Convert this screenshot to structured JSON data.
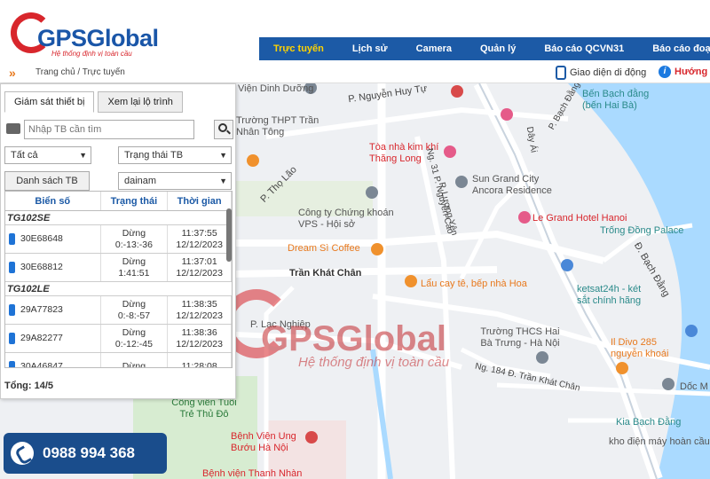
{
  "brand": {
    "name": "GPSGlobal",
    "tagline": "Hệ thống định vị toàn cầu"
  },
  "nav": {
    "items": [
      "Trực tuyến",
      "Lịch sử",
      "Camera",
      "Quản lý",
      "Báo cáo QCVN31",
      "Báo cáo đoạ"
    ],
    "active_index": 0
  },
  "breadcrumb": "Trang chủ / Trực tuyến",
  "header_links": {
    "mobile_ui": "Giao diện di động",
    "guide": "Hướng"
  },
  "panel": {
    "tabs": [
      "Giám sát thiết bị",
      "Xem lại lộ trình"
    ],
    "active_tab": 0,
    "search": {
      "placeholder": "Nhập TB cần tìm",
      "value": ""
    },
    "filter_all": "Tất cả",
    "filter_status": "Trạng thái TB",
    "device_list_button": "Danh sách TB",
    "account_select": "dainam",
    "table": {
      "headers": [
        "Biển số",
        "Trạng thái",
        "Thời gian"
      ],
      "groups": [
        {
          "name": "TG102SE",
          "rows": [
            {
              "plate": "30E68648",
              "status": "Dừng",
              "duration": "0:-13:-36",
              "time": "11:37:55",
              "date": "12/12/2023"
            },
            {
              "plate": "30E68812",
              "status": "Dừng",
              "duration": "1:41:51",
              "time": "11:37:01",
              "date": "12/12/2023"
            }
          ]
        },
        {
          "name": "TG102LE",
          "rows": [
            {
              "plate": "29A77823",
              "status": "Dừng",
              "duration": "0:-8:-57",
              "time": "11:38:35",
              "date": "12/12/2023"
            },
            {
              "plate": "29A82277",
              "status": "Dừng",
              "duration": "0:-12:-45",
              "time": "11:38:36",
              "date": "12/12/2023"
            },
            {
              "plate": "30A46847",
              "status": "Dừng",
              "duration": "",
              "time": "11:28:08",
              "date": ""
            }
          ]
        }
      ]
    },
    "total": "Tổng: 14/5"
  },
  "hotline": "0988 994 368",
  "watermark": {
    "text": "GPSGlobal",
    "sub": "Hệ thống định vị toàn cầu"
  },
  "map": {
    "labels": [
      "Viện Dinh Dưỡng",
      "P. Nguyễn Huy Tự",
      "Trường THPT Trần Nhân Tông",
      "Tòa nhà kim khí Thăng Long",
      "Sun Grand City Ancora Residence",
      "P. Thọ Lão",
      "Công ty Chứng khoán VPS - Hội sở",
      "Dream Sì Coffee",
      "Trần Khát Chân",
      "Lẩu cay tê, bếp nhà Hoa",
      "P. Lạc Nghiệp",
      "Trường THCS Hai Bà Trưng - Hà Nội",
      "Ng. 184 Đ. Trần Khát Chân",
      "Bến Bạch đằng (bến Hai Bà)",
      "Le Grand Hotel Hanoi",
      "Trống Đồng Palace",
      "Đ. Bạch Đằng",
      "ketsat24h - két sắt chính hãng",
      "Il Divo 285 nguyễn khoái",
      "Dốc M",
      "Kia Bạch Đằng",
      "kho điện máy hoàn cầu",
      "Công viên Tuổi Trẻ Thủ Đô",
      "Bệnh Viện Ung Bướu Hà Nội",
      "Bệnh viện Thanh Nhàn",
      "Ng. 31 P. Nguyễn Cao",
      "P. Lương Yên",
      "Dây Ái",
      "P. Bạch Đằng"
    ]
  },
  "colors": {
    "nav_bg": "#1c5aa6",
    "nav_active": "#ffd200",
    "brand_red": "#d8262c",
    "hotline_bg": "#1a4d8c"
  }
}
